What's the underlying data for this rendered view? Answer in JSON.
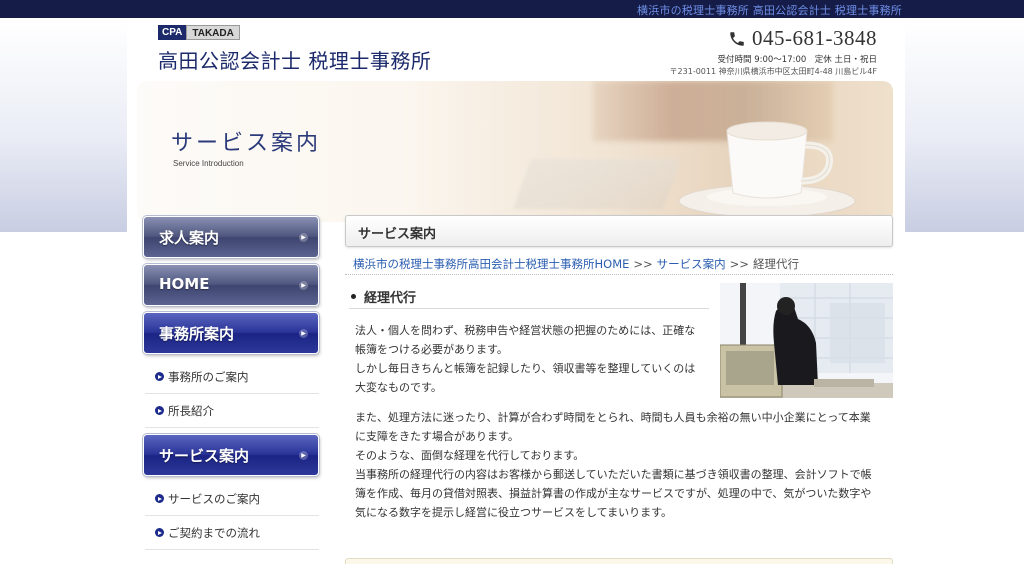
{
  "topbar": {
    "tagline": "横浜市の税理士事務所 高田公認会計士 税理士事務所"
  },
  "header": {
    "logo_cpa": "CPA",
    "logo_takada": "TAKADA",
    "site_name": "高田公認会計士 税理士事務所",
    "phone": "045-681-3848",
    "hours": "受付時間 9:00～17:00　定休 土日・祝日",
    "address": "〒231-0011 神奈川県横浜市中区太田町4-48 川島ビル4F"
  },
  "hero": {
    "title": "サービス案内",
    "subtitle": "Service Introduction"
  },
  "sidebar": {
    "nav": [
      {
        "label": "求人案内",
        "style": "gray"
      },
      {
        "label": "HOME",
        "style": "gray"
      },
      {
        "label": "事務所案内",
        "style": "blue"
      },
      {
        "label": "サービス案内",
        "style": "blue"
      }
    ],
    "office_sub": [
      "事務所のご案内",
      "所長紹介"
    ],
    "service_sub": [
      "サービスのご案内",
      "ご契約までの流れ"
    ]
  },
  "main": {
    "heading": "サービス案内",
    "breadcrumb": {
      "home": "横浜市の税理士事務所高田会計士税理士事務所HOME",
      "sep": ">>",
      "services": "サービス案内",
      "current": "経理代行"
    },
    "section_title": "経理代行",
    "para1": [
      "法人・個人を問わず、税務申告や経営状態の把握のためには、正確な",
      "帳簿をつける必要があります。",
      "しかし毎日きちんと帳簿を記録したり、領収書等を整理していくのは",
      "大変なものです。"
    ],
    "para2": [
      "また、処理方法に迷ったり、計算が合わず時間をとられ、時間も人員も余裕の無い中小企業にとって本業",
      "に支障をきたす場合があります。",
      "そのような、面倒な経理を代行しております。",
      "当事務所の経理代行の内容はお客様から郵送していただいた書類に基づき領収書の整理、会計ソフトで帳",
      "簿を作成、毎月の貸借対照表、損益計算書の作成が主なサービスですが、処理の中で、気がついた数字や",
      "気になる数字を提示し経営に役立つサービスをしてまいります。"
    ]
  },
  "colors": {
    "topbar_bg": "#151c47",
    "brand_navy": "#1c2a6b",
    "nav_blue": "#2a3498",
    "nav_gray": "#50577f",
    "link": "#2a5db0"
  },
  "icons": {
    "phone": "phone-icon",
    "nav_arrow": "chevron-right-icon",
    "sub_bullet": "circle-arrow-icon",
    "section_dot": "bullet-icon"
  }
}
